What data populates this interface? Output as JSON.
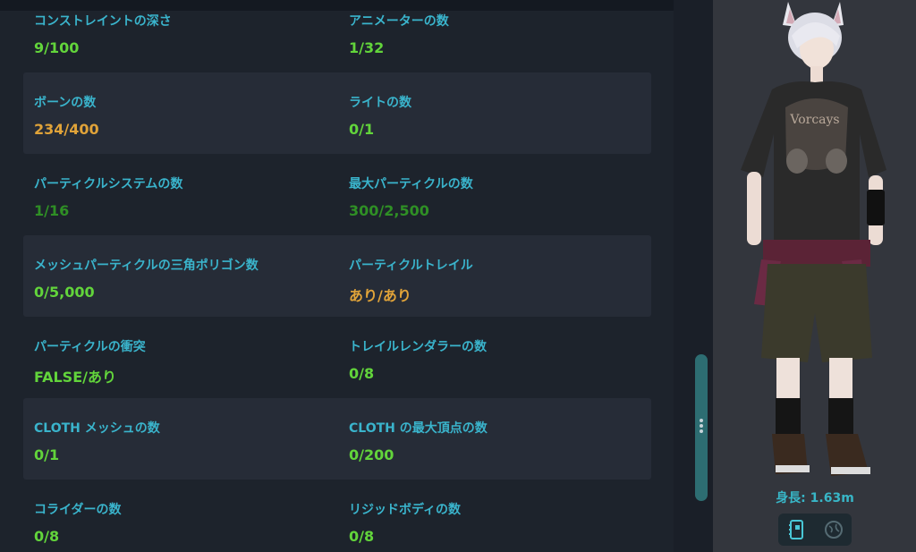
{
  "stats": [
    {
      "left": {
        "label": "コンストレイントの深さ",
        "value": "9/100",
        "color": "#62d43b"
      },
      "right": {
        "label": "アニメーターの数",
        "value": "1/32",
        "color": "#62d43b"
      }
    },
    {
      "left": {
        "label": "ボーンの数",
        "value": "234/400",
        "color": "#e0a339"
      },
      "right": {
        "label": "ライトの数",
        "value": "0/1",
        "color": "#62d43b"
      }
    },
    {
      "left": {
        "label": "パーティクルシステムの数",
        "value": "1/16",
        "color": "#2f8f25"
      },
      "right": {
        "label": "最大パーティクルの数",
        "value": "300/2,500",
        "color": "#2f8f25"
      }
    },
    {
      "left": {
        "label": "メッシュパーティクルの三角ポリゴン数",
        "value": "0/5,000",
        "color": "#62d43b"
      },
      "right": {
        "label": "パーティクルトレイル",
        "value": "あり/あり",
        "color": "#e0a339"
      }
    },
    {
      "left": {
        "label": "パーティクルの衝突",
        "value": "FALSE/あり",
        "color": "#62d43b"
      },
      "right": {
        "label": "トレイルレンダラーの数",
        "value": "0/8",
        "color": "#62d43b"
      }
    },
    {
      "left": {
        "label": "CLOTH メッシュの数",
        "value": "0/1",
        "color": "#62d43b"
      },
      "right": {
        "label": "CLOTH の最大頂点の数",
        "value": "0/200",
        "color": "#62d43b"
      }
    },
    {
      "left": {
        "label": "コライダーの数",
        "value": "0/8",
        "color": "#62d43b"
      },
      "right": {
        "label": "リジッドボディの数",
        "value": "0/8",
        "color": "#62d43b"
      }
    }
  ],
  "avatar_height": "身長: 1.63m",
  "icons": {
    "view_a": "clipboard-icon",
    "view_b": "globe-icon"
  }
}
